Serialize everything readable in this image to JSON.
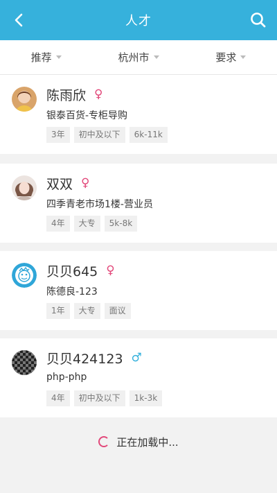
{
  "header": {
    "title": "人才",
    "back_icon": "chevron-left-icon",
    "search_icon": "search-icon",
    "bg_color": "#36b1dc"
  },
  "filters": [
    {
      "label": "推荐"
    },
    {
      "label": "杭州市"
    },
    {
      "label": "要求"
    }
  ],
  "candidates": [
    {
      "name": "陈雨欣",
      "gender": "♀",
      "gender_type": "female",
      "job": "银泰百货-专柜导购",
      "tags": [
        "3年",
        "初中及以下",
        "6k-11k"
      ]
    },
    {
      "name": "双双",
      "gender": "♀",
      "gender_type": "female",
      "job": "四季青老市场1楼-营业员",
      "tags": [
        "4年",
        "大专",
        "5k-8k"
      ]
    },
    {
      "name": "贝贝645",
      "gender": "♀",
      "gender_type": "female",
      "job": "陈德良-123",
      "tags": [
        "1年",
        "大专",
        "面议"
      ]
    },
    {
      "name": "贝贝424123",
      "gender": "♂",
      "gender_type": "male",
      "job": "php-php",
      "tags": [
        "4年",
        "初中及以下",
        "1k-3k"
      ]
    }
  ],
  "loading_text": "正在加载中...",
  "colors": {
    "female": "#e2487a",
    "male": "#36b1dc",
    "accent": "#36b1dc"
  }
}
